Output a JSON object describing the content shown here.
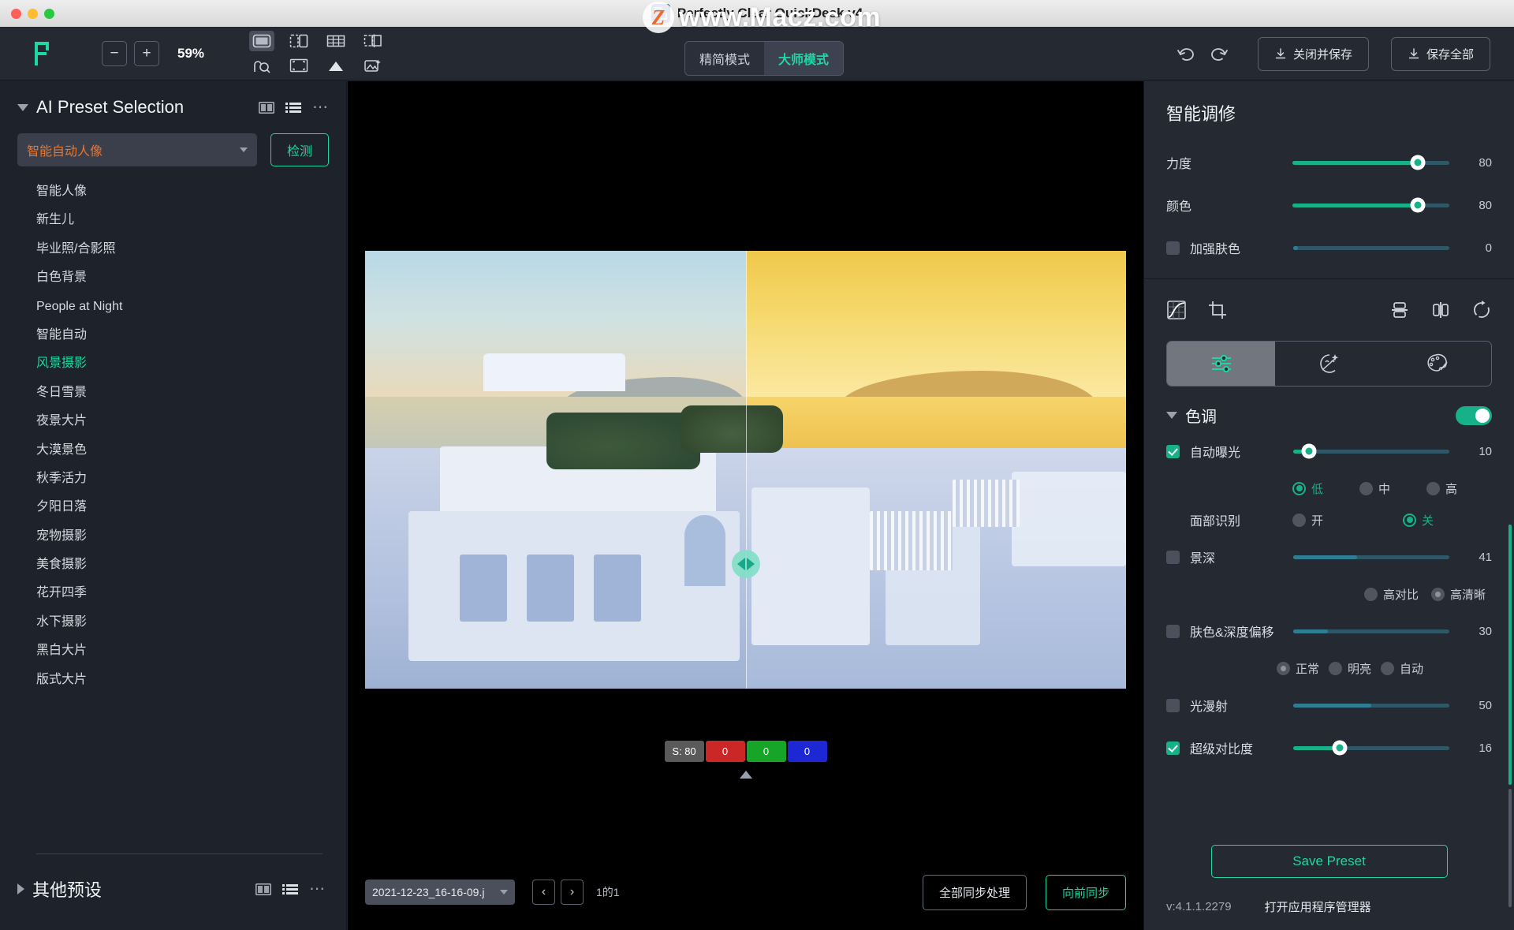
{
  "window": {
    "title": "Perfectly Clear QuickDesk v4",
    "watermark": "www.Macz.com",
    "watermark_badge": "Z"
  },
  "toolbar": {
    "zoom_out": "−",
    "zoom_in": "+",
    "zoom_level": "59%",
    "mode_tabs": [
      {
        "label": "精简模式",
        "active": false
      },
      {
        "label": "大师模式",
        "active": true
      }
    ],
    "close_and_save": "关闭并保存",
    "save_all": "保存全部"
  },
  "left_panel": {
    "section_title": "AI Preset Selection",
    "selected_preset_value": "智能自动人像",
    "detect_button": "检测",
    "presets": [
      {
        "label": "智能人像",
        "selected": false
      },
      {
        "label": "新生儿",
        "selected": false
      },
      {
        "label": "毕业照/合影照",
        "selected": false
      },
      {
        "label": "白色背景",
        "selected": false
      },
      {
        "label": "People at Night",
        "selected": false
      },
      {
        "label": "智能自动",
        "selected": false
      },
      {
        "label": "风景摄影",
        "selected": true
      },
      {
        "label": "冬日雪景",
        "selected": false
      },
      {
        "label": "夜景大片",
        "selected": false
      },
      {
        "label": "大漠景色",
        "selected": false
      },
      {
        "label": "秋季活力",
        "selected": false
      },
      {
        "label": "夕阳日落",
        "selected": false
      },
      {
        "label": "宠物摄影",
        "selected": false
      },
      {
        "label": "美食摄影",
        "selected": false
      },
      {
        "label": "花开四季",
        "selected": false
      },
      {
        "label": "水下摄影",
        "selected": false
      },
      {
        "label": "黑白大片",
        "selected": false
      },
      {
        "label": "版式大片",
        "selected": false
      }
    ],
    "other_presets_title": "其他预设"
  },
  "canvas": {
    "swatches": [
      {
        "label": "S: 80",
        "kind": "s"
      },
      {
        "label": "0",
        "kind": "r"
      },
      {
        "label": "0",
        "kind": "g"
      },
      {
        "label": "0",
        "kind": "b"
      }
    ],
    "file_name": "2021-12-23_16-16-09.j",
    "prev_label": "‹",
    "next_label": "›",
    "page_indicator": "1的1",
    "sync_all_button": "全部同步处理",
    "sync_forward_button": "向前同步"
  },
  "right_panel": {
    "title": "智能调修",
    "top_sliders": [
      {
        "label": "力度",
        "value": "80",
        "pct": 80,
        "checkbox": false,
        "filled": true
      },
      {
        "label": "颜色",
        "value": "80",
        "pct": 80,
        "checkbox": false,
        "filled": true
      },
      {
        "label": "加强肤色",
        "value": "0",
        "pct": 3,
        "checkbox": true,
        "checked": false,
        "filled": false
      }
    ],
    "section": {
      "title": "色调",
      "enabled": true
    },
    "controls": [
      {
        "label": "自动曝光",
        "value": "10",
        "pct": 10,
        "checked": true,
        "filled": true,
        "radios": [
          {
            "label": "低",
            "on": true
          },
          {
            "label": "中",
            "on": false
          },
          {
            "label": "高",
            "on": false
          }
        ]
      },
      {
        "label": "面部识别",
        "is_label_only": true,
        "radios": [
          {
            "label": "开",
            "on": false
          },
          {
            "label": "关",
            "on": true
          }
        ]
      },
      {
        "label": "景深",
        "value": "41",
        "pct": 41,
        "checked": false,
        "filled": false,
        "radios": [
          {
            "label": "高对比",
            "on": false
          },
          {
            "label": "高清晰",
            "on": true,
            "gray": true
          }
        ]
      },
      {
        "label": "肤色&深度偏移",
        "value": "30",
        "pct": 22,
        "checked": false,
        "filled": false,
        "radios": [
          {
            "label": "正常",
            "on": true,
            "gray": true
          },
          {
            "label": "明亮",
            "on": false
          },
          {
            "label": "自动",
            "on": false
          }
        ]
      },
      {
        "label": "光漫射",
        "value": "50",
        "pct": 50,
        "checked": false,
        "filled": false,
        "radios": []
      },
      {
        "label": "超级对比度",
        "value": "16",
        "pct": 30,
        "checked": true,
        "filled": true,
        "radios": []
      }
    ],
    "save_preset_button": "Save Preset",
    "version": "v:4.1.1.2279",
    "app_manager": "打开应用程序管理器"
  },
  "colors": {
    "accent": "#1fd6a4",
    "accent_slider": "#16b189",
    "orange": "#e8762c",
    "panel_bg": "#1e222b",
    "right_panel_bg": "#252932"
  }
}
